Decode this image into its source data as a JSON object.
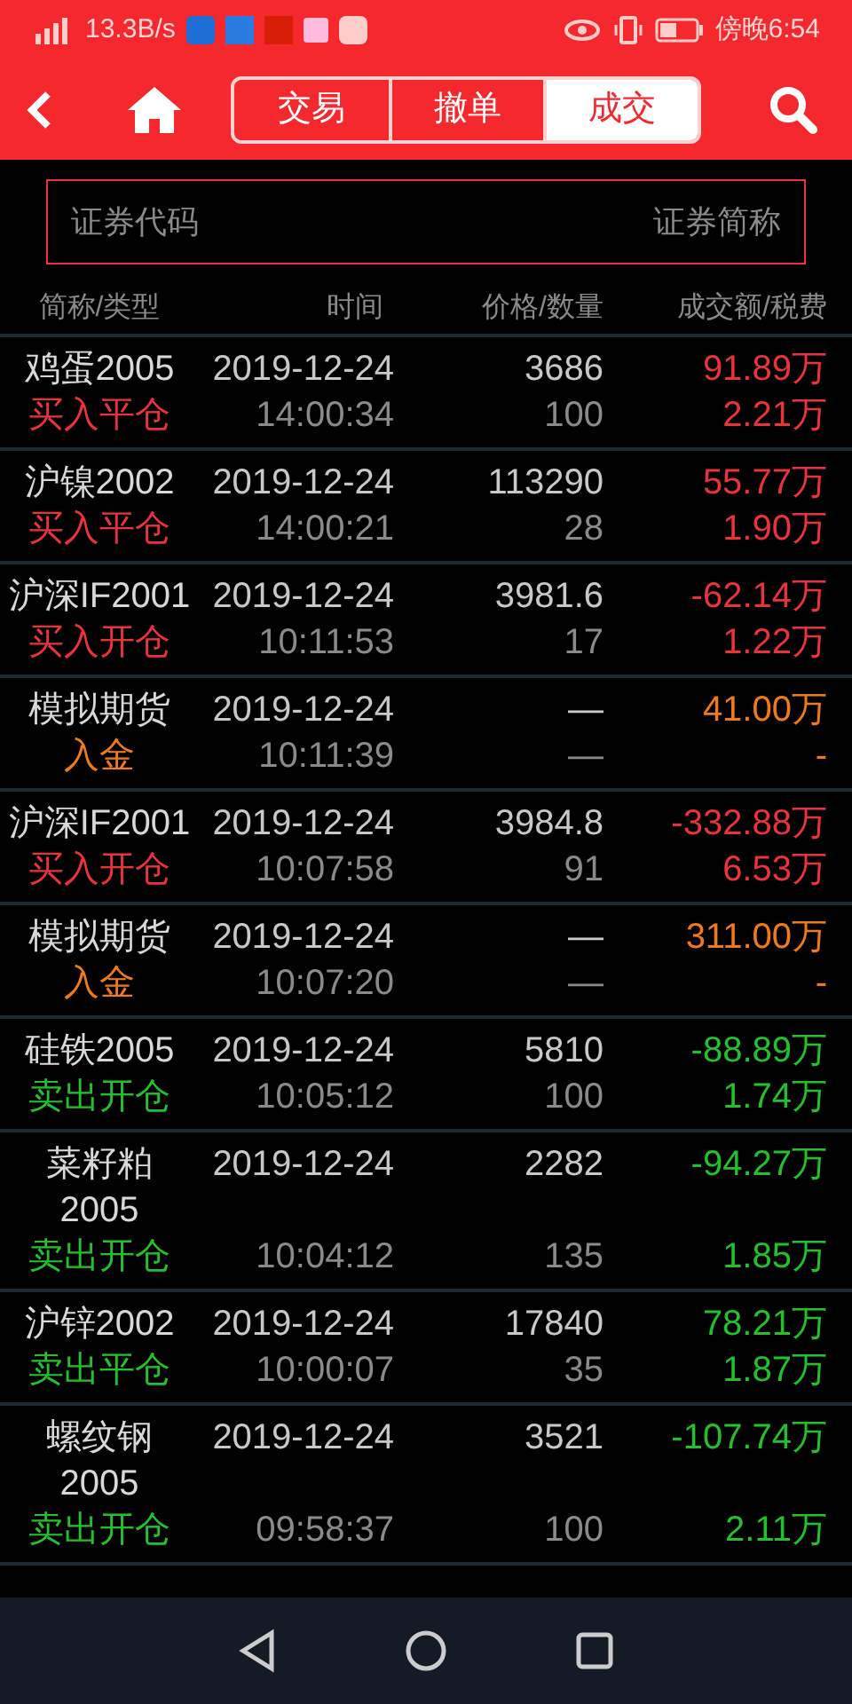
{
  "status_bar": {
    "speed": "13.3B/s",
    "time": "傍晚6:54"
  },
  "tabs": [
    {
      "label": "交易",
      "selected": false
    },
    {
      "label": "撤单",
      "selected": false
    },
    {
      "label": "成交",
      "selected": true
    }
  ],
  "search": {
    "placeholder_left": "证券代码",
    "placeholder_right": "证券简称"
  },
  "table": {
    "columns": [
      "简称/类型",
      "时间",
      "价格/数量",
      "成交额/税费"
    ],
    "rows": [
      {
        "name": "鸡蛋2005",
        "type": "买入平仓",
        "kind": "buy",
        "date": "2019-12-24",
        "time": "14:00:34",
        "price": "3686",
        "qty": "100",
        "amount": "91.89万",
        "fee": "2.21万"
      },
      {
        "name": "沪镍2002",
        "type": "买入平仓",
        "kind": "buy",
        "date": "2019-12-24",
        "time": "14:00:21",
        "price": "113290",
        "qty": "28",
        "amount": "55.77万",
        "fee": "1.90万"
      },
      {
        "name": "沪深IF2001",
        "type": "买入开仓",
        "kind": "buy",
        "date": "2019-12-24",
        "time": "10:11:53",
        "price": "3981.6",
        "qty": "17",
        "amount": "-62.14万",
        "fee": "1.22万"
      },
      {
        "name": "模拟期货",
        "type": "入金",
        "kind": "deposit",
        "date": "2019-12-24",
        "time": "10:11:39",
        "price": "—",
        "qty": "—",
        "amount": "41.00万",
        "fee": "-"
      },
      {
        "name": "沪深IF2001",
        "type": "买入开仓",
        "kind": "buy",
        "date": "2019-12-24",
        "time": "10:07:58",
        "price": "3984.8",
        "qty": "91",
        "amount": "-332.88万",
        "fee": "6.53万"
      },
      {
        "name": "模拟期货",
        "type": "入金",
        "kind": "deposit",
        "date": "2019-12-24",
        "time": "10:07:20",
        "price": "—",
        "qty": "—",
        "amount": "311.00万",
        "fee": "-"
      },
      {
        "name": "硅铁2005",
        "type": "卖出开仓",
        "kind": "sell",
        "date": "2019-12-24",
        "time": "10:05:12",
        "price": "5810",
        "qty": "100",
        "amount": "-88.89万",
        "fee": "1.74万"
      },
      {
        "name": "菜籽粕 2005",
        "type": "卖出开仓",
        "kind": "sell",
        "date": "2019-12-24",
        "time": "10:04:12",
        "price": "2282",
        "qty": "135",
        "amount": "-94.27万",
        "fee": "1.85万"
      },
      {
        "name": "沪锌2002",
        "type": "卖出平仓",
        "kind": "sell",
        "date": "2019-12-24",
        "time": "10:00:07",
        "price": "17840",
        "qty": "35",
        "amount": "78.21万",
        "fee": "1.87万"
      },
      {
        "name": "螺纹钢 2005",
        "type": "卖出开仓",
        "kind": "sell",
        "date": "2019-12-24",
        "time": "09:58:37",
        "price": "3521",
        "qty": "100",
        "amount": "-107.74万",
        "fee": "2.11万"
      }
    ]
  }
}
